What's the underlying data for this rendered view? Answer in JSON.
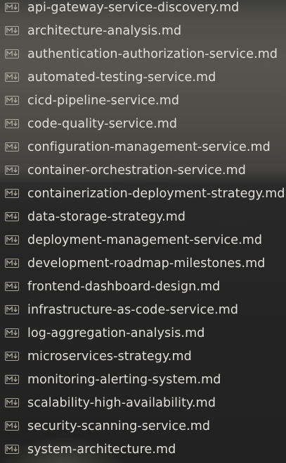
{
  "explorer": {
    "files": [
      {
        "name": "api-gateway-service-discovery.md",
        "icon": "markdown-icon"
      },
      {
        "name": "architecture-analysis.md",
        "icon": "markdown-icon"
      },
      {
        "name": "authentication-authorization-service.md",
        "icon": "markdown-icon"
      },
      {
        "name": "automated-testing-service.md",
        "icon": "markdown-icon"
      },
      {
        "name": "cicd-pipeline-service.md",
        "icon": "markdown-icon"
      },
      {
        "name": "code-quality-service.md",
        "icon": "markdown-icon"
      },
      {
        "name": "configuration-management-service.md",
        "icon": "markdown-icon"
      },
      {
        "name": "container-orchestration-service.md",
        "icon": "markdown-icon"
      },
      {
        "name": "containerization-deployment-strategy.md",
        "icon": "markdown-icon"
      },
      {
        "name": "data-storage-strategy.md",
        "icon": "markdown-icon"
      },
      {
        "name": "deployment-management-service.md",
        "icon": "markdown-icon"
      },
      {
        "name": "development-roadmap-milestones.md",
        "icon": "markdown-icon"
      },
      {
        "name": "frontend-dashboard-design.md",
        "icon": "markdown-icon"
      },
      {
        "name": "infrastructure-as-code-service.md",
        "icon": "markdown-icon"
      },
      {
        "name": "log-aggregation-analysis.md",
        "icon": "markdown-icon"
      },
      {
        "name": "microservices-strategy.md",
        "icon": "markdown-icon"
      },
      {
        "name": "monitoring-alerting-system.md",
        "icon": "markdown-icon"
      },
      {
        "name": "scalability-high-availability.md",
        "icon": "markdown-icon"
      },
      {
        "name": "security-scanning-service.md",
        "icon": "markdown-icon"
      },
      {
        "name": "system-architecture.md",
        "icon": "markdown-icon"
      }
    ]
  },
  "colors": {
    "text": "#e1dfd8",
    "icon": "#b5b1a4"
  }
}
